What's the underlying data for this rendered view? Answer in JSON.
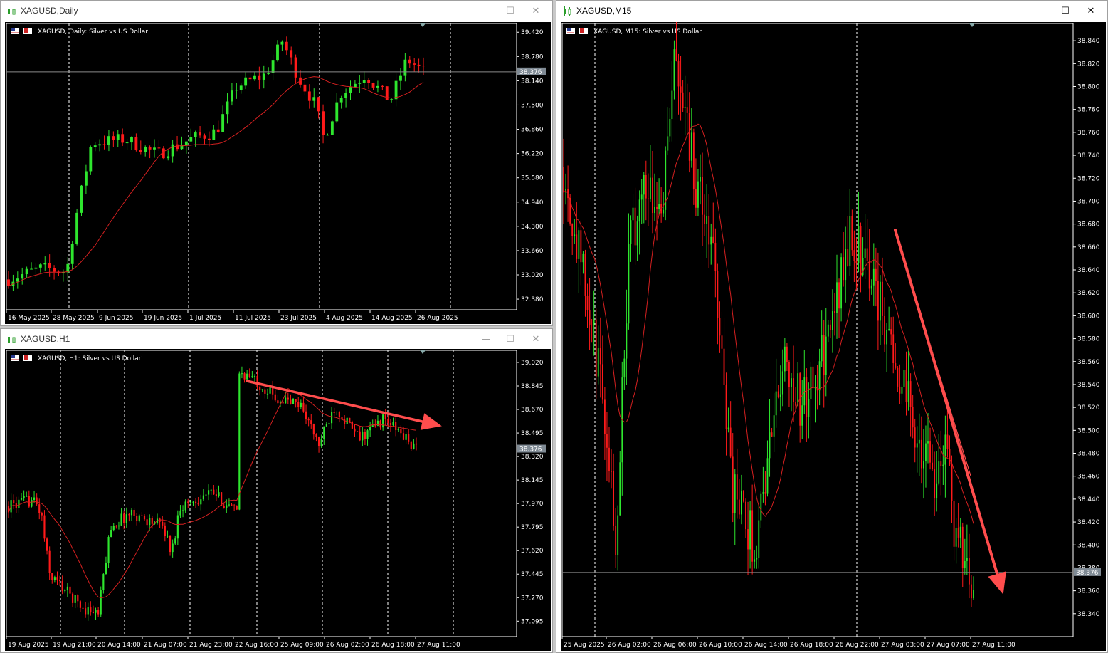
{
  "windows": [
    {
      "id": "daily",
      "title": "XAGUSD,Daily",
      "active": false,
      "header": "XAGUSD, Daily:  Silver vs US Dollar",
      "price_label": "38.376",
      "y_ticks": [
        "39.420",
        "38.780",
        "38.140",
        "37.500",
        "36.860",
        "36.220",
        "35.580",
        "34.940",
        "34.300",
        "33.660",
        "33.020",
        "32.380"
      ],
      "x_ticks": [
        "16 May 2025",
        "28 May 2025",
        "9 Jun 2025",
        "19 Jun 2025",
        "1 Jul 2025",
        "11 Jul 2025",
        "23 Jul 2025",
        "4 Aug 2025",
        "14 Aug 2025",
        "26 Aug 2025"
      ]
    },
    {
      "id": "h1",
      "title": "XAGUSD,H1",
      "active": false,
      "header": "XAGUSD, H1:  Silver vs US Dollar",
      "price_label": "38.376",
      "y_ticks": [
        "39.020",
        "38.845",
        "38.670",
        "38.495",
        "38.320",
        "38.145",
        "37.970",
        "37.795",
        "37.620",
        "37.445",
        "37.270",
        "37.095"
      ],
      "x_ticks": [
        "19 Aug 2025",
        "19 Aug 21:00",
        "20 Aug 14:00",
        "21 Aug 07:00",
        "21 Aug 23:00",
        "22 Aug 16:00",
        "25 Aug 09:00",
        "26 Aug 02:00",
        "26 Aug 18:00",
        "27 Aug 11:00"
      ]
    },
    {
      "id": "m15",
      "title": "XAGUSD,M15",
      "active": true,
      "header": "XAGUSD, M15:  Silver vs US Dollar",
      "price_label": "38.376",
      "y_ticks": [
        "38.840",
        "38.820",
        "38.800",
        "38.780",
        "38.760",
        "38.740",
        "38.720",
        "38.700",
        "38.680",
        "38.660",
        "38.640",
        "38.620",
        "38.600",
        "38.580",
        "38.560",
        "38.540",
        "38.520",
        "38.500",
        "38.480",
        "38.460",
        "38.440",
        "38.420",
        "38.400",
        "38.380",
        "38.360",
        "38.340"
      ],
      "x_ticks": [
        "25 Aug 2025",
        "26 Aug 02:00",
        "26 Aug 06:00",
        "26 Aug 10:00",
        "26 Aug 14:00",
        "26 Aug 18:00",
        "26 Aug 22:00",
        "27 Aug 03:00",
        "27 Aug 07:00",
        "27 Aug 11:00"
      ]
    }
  ],
  "window_buttons": {
    "minimize": "—",
    "maximize": "☐",
    "close": "✕"
  },
  "colors": {
    "bull": "#2ee62e",
    "bear": "#ff1a1a",
    "ma": "#d42020",
    "arrow": "#ff4d4d",
    "grid": "#ffffff",
    "bg": "#000000"
  },
  "chart_data": [
    {
      "type": "candlestick",
      "symbol": "XAGUSD",
      "timeframe": "Daily",
      "ylim": [
        32.1,
        39.65
      ],
      "last": 38.376
    },
    {
      "type": "candlestick",
      "symbol": "XAGUSD",
      "timeframe": "H1",
      "ylim": [
        36.98,
        39.11
      ],
      "last": 38.376
    },
    {
      "type": "candlestick",
      "symbol": "XAGUSD",
      "timeframe": "M15",
      "ylim": [
        38.32,
        38.855
      ],
      "last": 38.376
    }
  ]
}
